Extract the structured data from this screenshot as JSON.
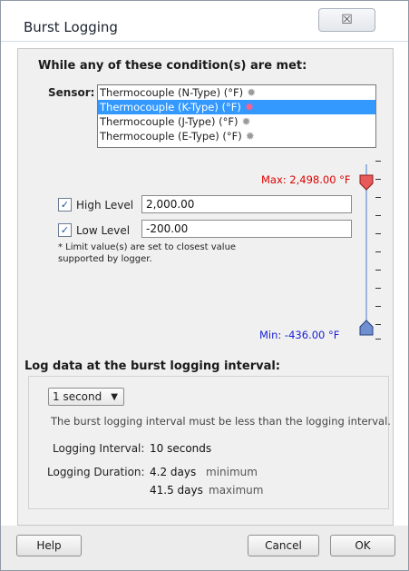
{
  "window": {
    "title": "Burst Logging",
    "close_glyph": "☒"
  },
  "conditions": {
    "heading": "While any of these condition(s) are met:",
    "sensor_label": "Sensor:",
    "sensors": [
      {
        "label": "Thermocouple (N-Type) (°F)",
        "icon": "burst-gear-icon"
      },
      {
        "label": "Thermocouple (K-Type) (°F)",
        "icon": "burst-gear-icon",
        "selected": true
      },
      {
        "label": "Thermocouple (J-Type) (°F)",
        "icon": "burst-gear-icon"
      },
      {
        "label": "Thermocouple (E-Type) (°F)",
        "icon": "burst-gear-icon"
      }
    ],
    "max_label": "Max: 2,498.00 °F",
    "min_label": "Min: -436.00 °F",
    "high_level": {
      "label": "High Level",
      "checked": true,
      "value": "2,000.00"
    },
    "low_level": {
      "label": "Low Level",
      "checked": true,
      "value": "-200.00"
    },
    "note": "*  Limit value(s) are set to closest value supported by logger.",
    "slider": {
      "max": 2498.0,
      "min": -436.0,
      "high": 2000.0,
      "low": -200.0
    }
  },
  "interval": {
    "heading": "Log data at the burst logging interval:",
    "selected": "1 second",
    "hint": "The burst logging interval must be less than the logging interval."
  },
  "stats": {
    "logging_interval_label": "Logging Interval:",
    "logging_interval_value": "10 seconds",
    "logging_duration_label": "Logging Duration:",
    "duration_min_value": "4.2 days",
    "duration_min_qualifier": "minimum",
    "duration_max_value": "41.5 days",
    "duration_max_qualifier": "maximum"
  },
  "footer": {
    "help": "Help",
    "cancel": "Cancel",
    "ok": "OK"
  },
  "colors": {
    "max_red": "#e00000",
    "min_blue": "#1a22d6",
    "selection": "#3399ff"
  }
}
